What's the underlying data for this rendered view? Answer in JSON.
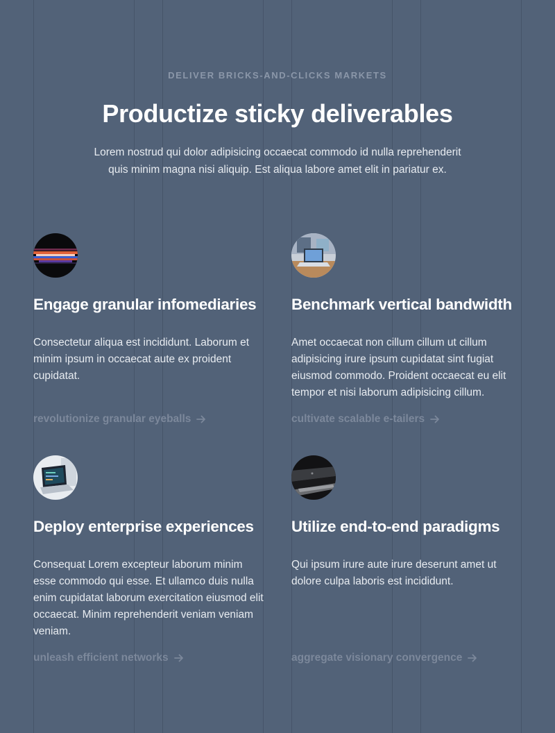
{
  "section": {
    "eyebrow": "DELIVER BRICKS-AND-CLICKS MARKETS",
    "title": "Productize sticky deliverables",
    "intro": "Lorem nostrud qui dolor adipisicing occaecat commodo id nulla reprehenderit quis minim magna nisi aliquip. Est aliqua labore amet elit in pariatur ex."
  },
  "features": [
    {
      "title": "Engage granular infomediaries",
      "body": "Consectetur aliqua est incididunt. Laborum et minim ipsum in occaecat aute ex proident cupidatat.",
      "link": "revolutionize granular eyeballs",
      "image_icon": "light-streaks-image"
    },
    {
      "title": "Benchmark vertical bandwidth",
      "body": "Amet occaecat non cillum cillum ut cillum adipisicing irure ipsum cupidatat sint fugiat eiusmod commodo. Proident occaecat eu elit tempor et nisi laborum adipisicing cillum.",
      "link": "cultivate scalable e-tailers",
      "image_icon": "laptop-desk-image"
    },
    {
      "title": "Deploy enterprise experiences",
      "body": "Consequat Lorem excepteur laborum minim esse commodo qui esse. Et ullamco duis nulla enim cupidatat laborum exercitation eiusmod elit occaecat. Minim reprehenderit veniam veniam veniam.",
      "link": "unleash efficient networks",
      "image_icon": "laptop-code-image"
    },
    {
      "title": "Utilize end-to-end paradigms",
      "body": "Qui ipsum irure aute irure deserunt amet ut dolore culpa laboris est incididunt.",
      "link": "aggregate visionary convergence",
      "image_icon": "dark-laptop-image"
    }
  ],
  "colors": {
    "background": "#526278",
    "heading": "#ffffff",
    "body_text": "#e8ecf1",
    "muted_link": "#7c889b",
    "eyebrow": "#8b97a9"
  }
}
